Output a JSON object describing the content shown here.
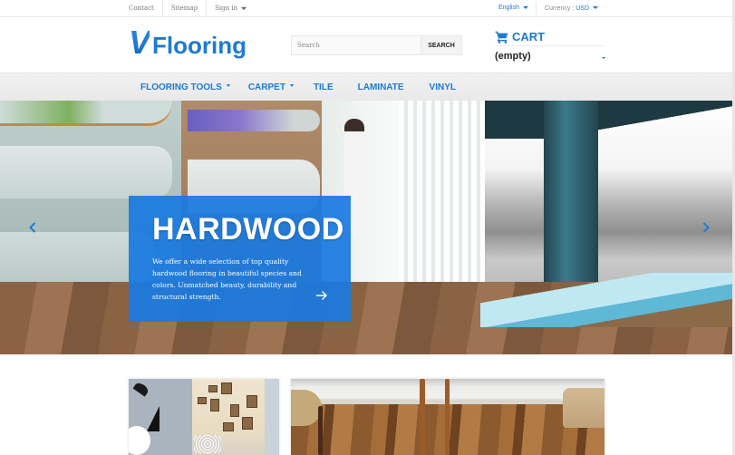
{
  "topbar": {
    "links": [
      "Contact",
      "Sitemap",
      "Sign in"
    ],
    "language": "English",
    "currency_label": "Currency :",
    "currency_value": "USD"
  },
  "header": {
    "logo_mark": "V",
    "logo_text": "Flooring",
    "search_placeholder": "Search",
    "search_button": "SEARCH",
    "cart_label": "CART",
    "cart_status": "(empty)"
  },
  "nav": {
    "items": [
      {
        "label": "FLOORING TOOLS",
        "has_dropdown": true
      },
      {
        "label": "CARPET",
        "has_dropdown": true
      },
      {
        "label": "TILE",
        "has_dropdown": false
      },
      {
        "label": "LAMINATE",
        "has_dropdown": false
      },
      {
        "label": "VINYL",
        "has_dropdown": false
      }
    ]
  },
  "hero": {
    "title": "HARDWOOD",
    "description": "We offer a wide selection of top quality hardwood flooring in beautiful species and colors. Unmatched beauty, durability and structural strength.",
    "cta_icon": "arrow-right-icon",
    "prev_icon": "chevron-left-icon",
    "next_icon": "chevron-right-icon"
  },
  "colors": {
    "brand_blue": "#1c7ad6",
    "caption_bg": "#1a7ae0",
    "nav_bg": "#eeeeee"
  }
}
